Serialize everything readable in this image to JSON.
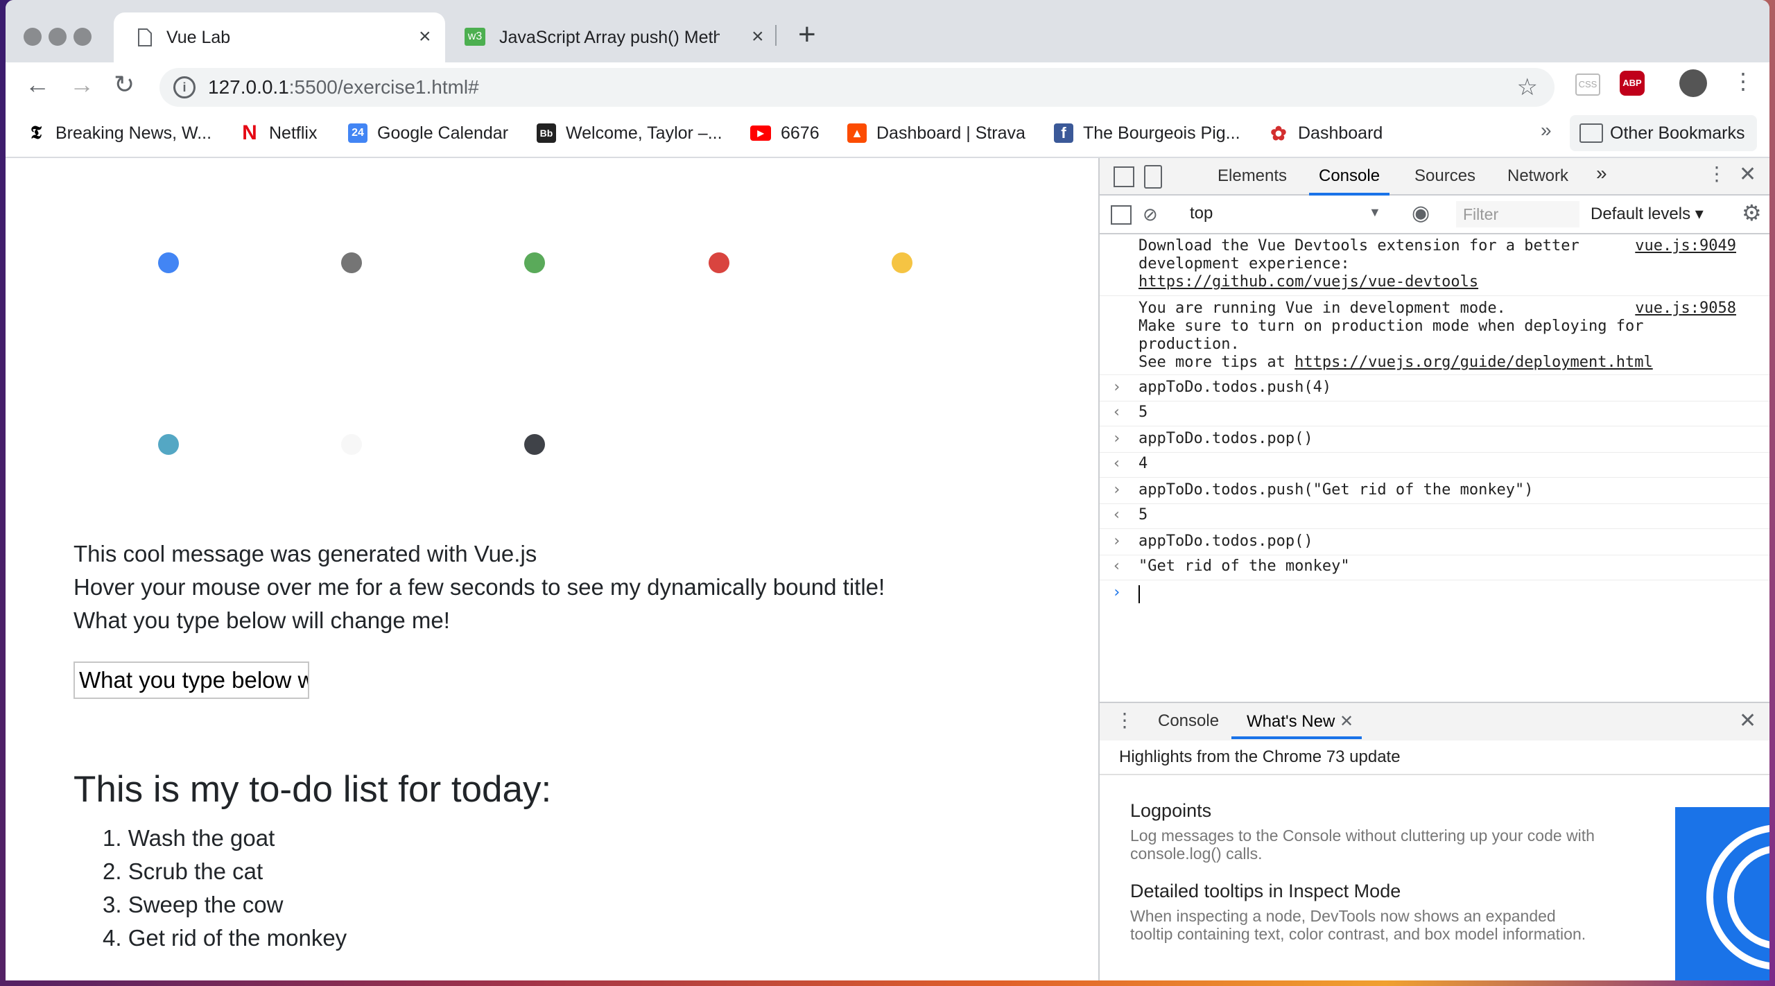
{
  "browser": {
    "tabs": [
      {
        "title": "Vue Lab",
        "active": true
      },
      {
        "title": "JavaScript Array push() Metho",
        "active": false
      }
    ],
    "new_tab": "+",
    "url_host": "127.0.0.1",
    "url_path": ":5500/exercise1.html#",
    "bookmarks": [
      {
        "label": "Breaking News, W...",
        "icon": "nyt-icon"
      },
      {
        "label": "Netflix",
        "icon": "netflix-icon"
      },
      {
        "label": "Google Calendar",
        "icon": "calendar-icon"
      },
      {
        "label": "Welcome, Taylor –...",
        "icon": "blackboard-icon"
      },
      {
        "label": "6676",
        "icon": "youtube-icon"
      },
      {
        "label": "Dashboard | Strava",
        "icon": "strava-icon"
      },
      {
        "label": "The Bourgeois Pig...",
        "icon": "facebook-icon"
      },
      {
        "label": "Dashboard",
        "icon": "dashboard-icon"
      }
    ],
    "overflow": "»",
    "other_bookmarks": "Other Bookmarks"
  },
  "page": {
    "dot_colors": [
      "#4285f4",
      "#757575",
      "#5aaa5a",
      "#d9443f",
      "#f5c443",
      "#54a7c4",
      "#f7f7f7",
      "#3f4248"
    ],
    "message1": "This cool message was generated with Vue.js",
    "message2": "Hover your mouse over me for a few seconds to see my dynamically bound title!",
    "message3": "What you type below will change me!",
    "input_value": "What you type below will change me!",
    "todo_heading": "This is my to-do list for today:",
    "todos": [
      "1. Wash the goat",
      "2. Scrub the cat",
      "3. Sweep the cow",
      "4. Get rid of the monkey"
    ]
  },
  "devtools": {
    "tabs": [
      "Elements",
      "Console",
      "Sources",
      "Network"
    ],
    "more_tabs": "»",
    "context": "top",
    "filter_placeholder": "Filter",
    "levels": "Default levels",
    "messages": [
      {
        "line1": "Download the Vue Devtools extension for a better",
        "line2": "development experience:",
        "link": "https://github.com/vuejs/vue-devtools",
        "source": "vue.js:9049"
      },
      {
        "line1": "You are running Vue in development mode.",
        "line2": "Make sure to turn on production mode when deploying for",
        "line3": "production.",
        "line4_prefix": "See more tips at ",
        "link": "https://vuejs.org/guide/deployment.html",
        "source": "vue.js:9058"
      }
    ],
    "entries": [
      {
        "input": "appToDo.todos.push(4)",
        "result": "5"
      },
      {
        "input": "appToDo.todos.pop()",
        "result": "4"
      },
      {
        "input": "appToDo.todos.push(\"Get rid of the monkey\")",
        "result": "5"
      },
      {
        "input": "appToDo.todos.pop()",
        "result": "\"Get rid of the monkey\""
      }
    ],
    "drawer_tabs": [
      "Console",
      "What's New"
    ],
    "highlight": "Highlights from the Chrome 73 update",
    "features": [
      {
        "title": "Logpoints",
        "desc": "Log messages to the Console without cluttering up your code with console.log() calls."
      },
      {
        "title": "Detailed tooltips in Inspect Mode",
        "desc": "When inspecting a node, DevTools now shows an expanded tooltip containing text, color contrast, and box model information."
      }
    ]
  }
}
